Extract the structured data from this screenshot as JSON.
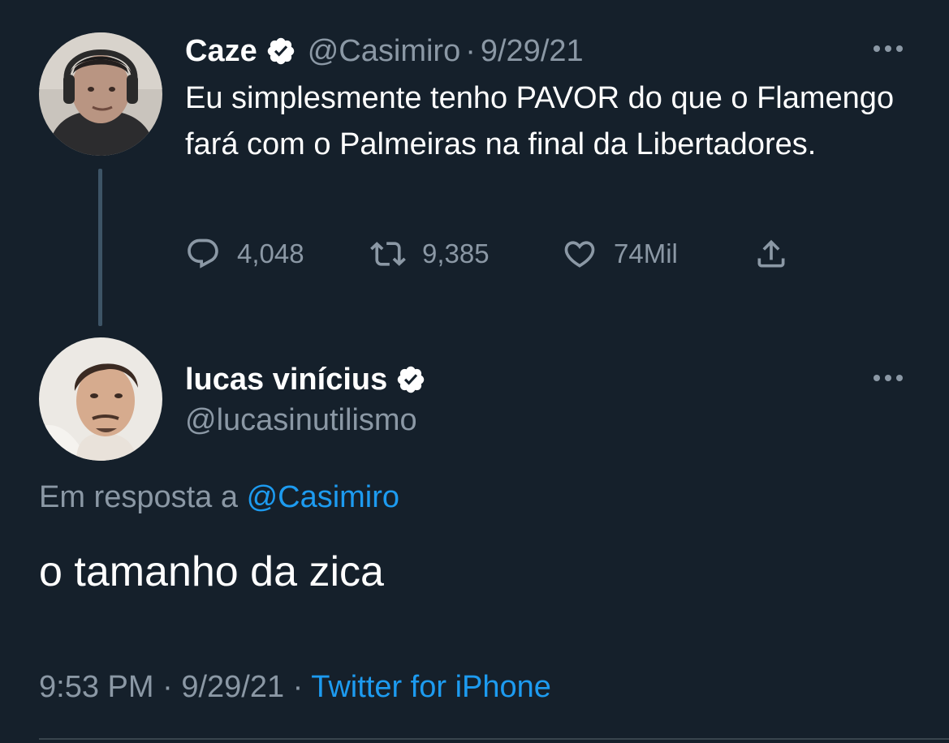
{
  "colors": {
    "background": "#15202b",
    "text_primary": "#ffffff",
    "text_secondary": "#8b98a5",
    "accent": "#1d9bf0",
    "verified_badge": "#ffffff"
  },
  "tweet_parent": {
    "display_name": "Caze",
    "handle": "@Casimiro",
    "date": "9/29/21",
    "text": "Eu simplesmente tenho PAVOR do que o Flamengo fará com o Palmeiras na final da Libertadores.",
    "avatar_icon": "user-avatar-photo",
    "verified_icon": "verified-badge-icon",
    "more_icon": "more-options-icon",
    "actions": {
      "reply_count": "4,048",
      "retweet_count": "9,385",
      "like_count": "74Mil",
      "reply_icon": "reply-bubble-icon",
      "retweet_icon": "retweet-icon",
      "like_icon": "heart-icon",
      "share_icon": "share-icon"
    }
  },
  "tweet_reply": {
    "display_name": "lucas vinícius",
    "handle": "@lucasinutilismo",
    "reply_prefix": "Em resposta a",
    "reply_mention": "@Casimiro",
    "text": "o tamanho da zica",
    "time": "9:53 PM",
    "date": "9/29/21",
    "source": "Twitter for iPhone",
    "avatar_icon": "user-avatar-photo",
    "verified_icon": "verified-badge-icon",
    "more_icon": "more-options-icon"
  }
}
